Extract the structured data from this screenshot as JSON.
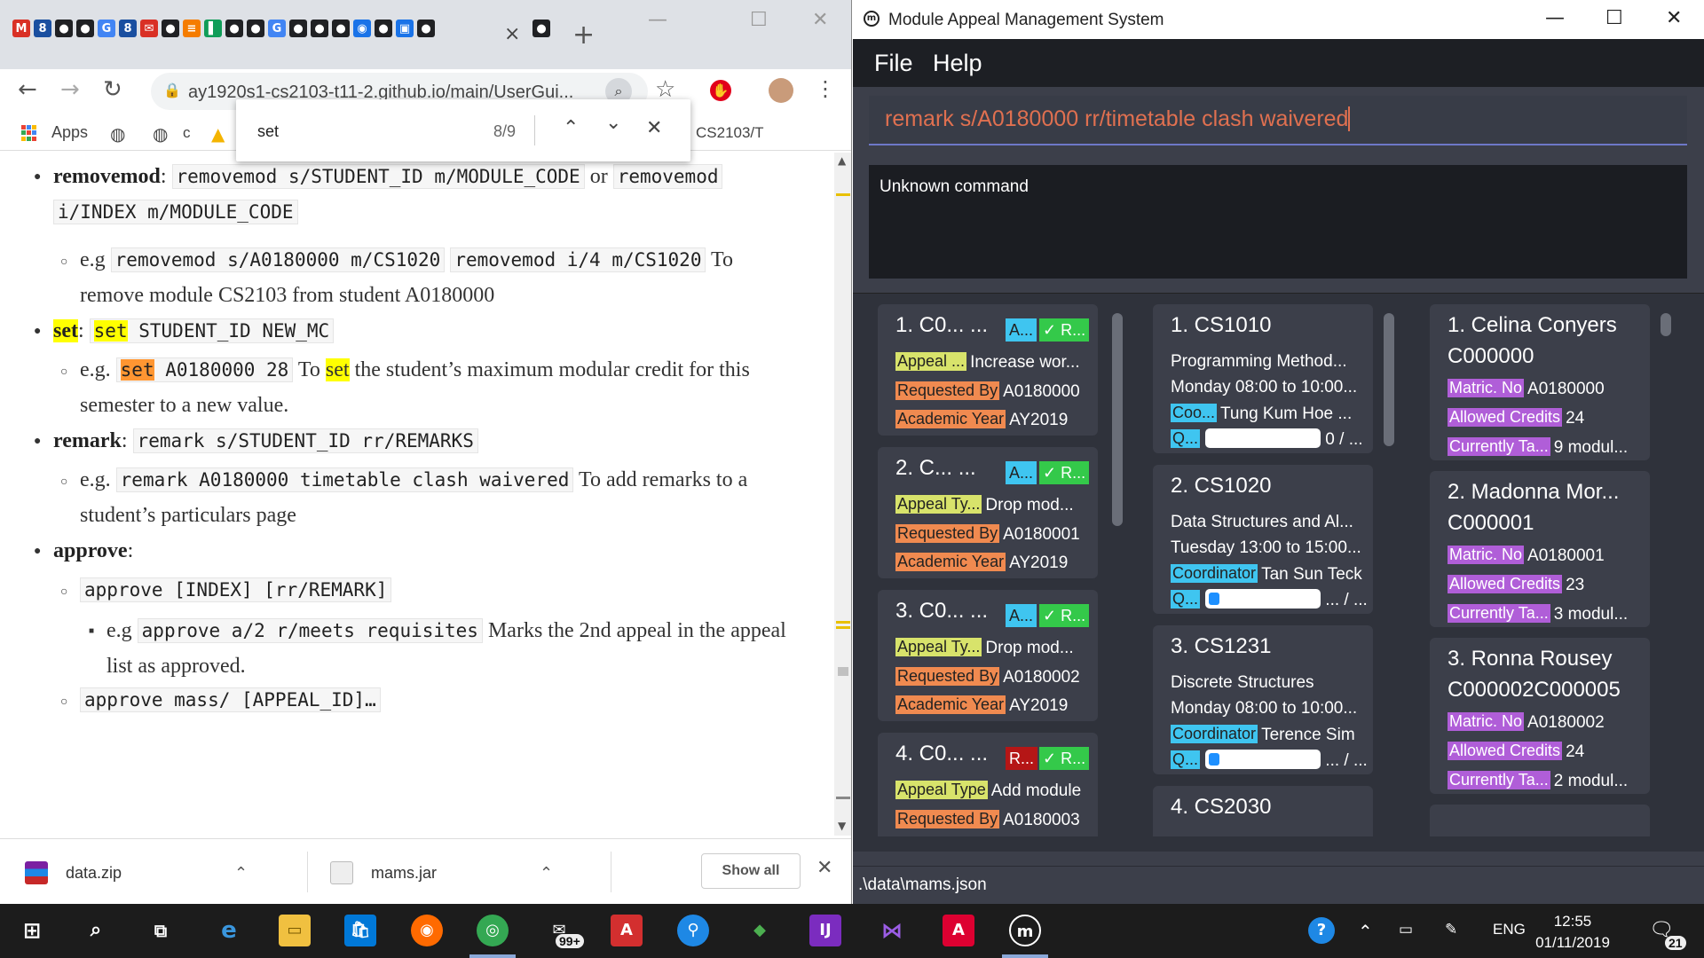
{
  "browser": {
    "tab_close": "×",
    "new_tab": "+",
    "window_controls": [
      "—",
      "☐",
      "✕"
    ],
    "url": "ay1920s1-cs2103-t11-2.github.io/main/UserGui...",
    "bookmarks": {
      "apps_label": "Apps",
      "item_c": "c",
      "item_cs2103": "CS2103/T"
    },
    "find_bar": {
      "query": "set",
      "count": "8/9"
    },
    "content": {
      "removemod_term": "removemod",
      "removemod_sep": ":",
      "removemod_syntax1": "removemod s/STUDENT_ID m/MODULE_CODE",
      "removemod_or": "or",
      "removemod_syntax2a": "removemod",
      "removemod_syntax2b": "i/INDEX m/MODULE_CODE",
      "removemod_eg": "e.g",
      "removemod_ex1": "removemod s/A0180000 m/CS1020",
      "removemod_ex2": "removemod i/4 m/CS1020",
      "removemod_desc1": "To",
      "removemod_desc2": "remove module CS2103 from student A0180000",
      "set_term": "set",
      "set_sep": ":",
      "set_syntax_kw": "set",
      "set_syntax_rest": "STUDENT_ID NEW_MC",
      "set_eg": "e.g.",
      "set_ex_kw": "set",
      "set_ex_rest": "A0180000 28",
      "set_desc_a": "To",
      "set_desc_kw": "set",
      "set_desc_b": "the student’s maximum modular credit for this",
      "set_desc_c": "semester to a new value.",
      "remark_term": "remark",
      "remark_sep": ":",
      "remark_syntax": "remark s/STUDENT_ID rr/REMARKS",
      "remark_eg": "e.g.",
      "remark_ex": "remark A0180000 timetable clash waivered",
      "remark_desc1": "To add remarks to a",
      "remark_desc2": "student’s particulars page",
      "approve_term": "approve",
      "approve_sep": ":",
      "approve_syntax": "approve [INDEX] [rr/REMARK]",
      "approve_eg": "e.g",
      "approve_ex": "approve a/2 r/meets requisites",
      "approve_desc1": "Marks the 2nd appeal in the appeal",
      "approve_desc2": "list as approved.",
      "approve_mass": "approve mass/ [APPEAL_ID]…"
    },
    "downloads": {
      "items": [
        {
          "name": "data.zip"
        },
        {
          "name": "mams.jar"
        }
      ],
      "show_all": "Show all",
      "close": "✕"
    }
  },
  "app": {
    "title": "Module Appeal Management System",
    "logo_letter": "m",
    "menu": [
      "File",
      "Help"
    ],
    "command_text": "remark s/A0180000 rr/timetable clash waivered",
    "result_text": "Unknown command",
    "status_path": ".\\data\\mams.json",
    "appeals": [
      {
        "head": "1.  C0...   ...",
        "status1": "A...",
        "status2": "✓ R...",
        "l1_tag": "Appeal ...",
        "l1_val": "Increase wor...",
        "l2_tag": "Requested By",
        "l2_val": "A0180000",
        "l3_tag": "Academic Year",
        "l3_val": "AY2019"
      },
      {
        "head": "2.  C...    ...",
        "status1": "A...",
        "status2": "✓ R...",
        "l1_tag": "Appeal Ty...",
        "l1_val": "Drop mod...",
        "l2_tag": "Requested By",
        "l2_val": "A0180001",
        "l3_tag": "Academic Year",
        "l3_val": "AY2019"
      },
      {
        "head": "3.  C0...   ...",
        "status1": "A...",
        "status2": "✓ R...",
        "l1_tag": "Appeal Ty...",
        "l1_val": "Drop mod...",
        "l2_tag": "Requested By",
        "l2_val": "A0180002",
        "l3_tag": "Academic Year",
        "l3_val": "AY2019"
      },
      {
        "head": "4.  C0...   ...",
        "status1": "R...",
        "status2": "✓ R...",
        "l1_tag": "Appeal Type",
        "l1_val": "Add module",
        "l2_tag": "Requested By",
        "l2_val": "A0180003"
      }
    ],
    "modules": [
      {
        "head": "1.  CS1010",
        "name": "Programming Method...",
        "time": "Monday 08:00 to 10:00...",
        "coord_tag": "Coo...",
        "coord_val": "Tung Kum Hoe ...",
        "q_tag": "Q...",
        "quota": "0 / ...",
        "fill": 0.0
      },
      {
        "head": "2.  CS1020",
        "name": "Data Structures and Al...",
        "time": "Tuesday 13:00 to 15:00...",
        "coord_tag": "Coordinator",
        "coord_val": "Tan Sun Teck",
        "q_tag": "Q...",
        "quota": "... / ...",
        "fill": 0.08
      },
      {
        "head": "3.  CS1231",
        "name": "Discrete Structures",
        "time": "Monday 08:00 to 10:00...",
        "coord_tag": "Coordinator",
        "coord_val": "Terence Sim",
        "q_tag": "Q...",
        "quota": "... / ...",
        "fill": 0.1
      },
      {
        "head": "4.  CS2030"
      }
    ],
    "students": [
      {
        "head": "1.  Celina Conyers",
        "id": "C000000",
        "l1_tag": "Matric. No",
        "l1_val": "A0180000",
        "l2_tag": "Allowed Credits",
        "l2_val": "24",
        "l3_tag": "Currently Ta...",
        "l3_val": "9  modul..."
      },
      {
        "head": "2.  Madonna Mor...",
        "id": "C000001",
        "l1_tag": "Matric. No",
        "l1_val": "A0180001",
        "l2_tag": "Allowed Credits",
        "l2_val": "23",
        "l3_tag": "Currently Ta...",
        "l3_val": "3  modul..."
      },
      {
        "head": "3.  Ronna Rousey",
        "id": "C000002C000005",
        "l1_tag": "Matric. No",
        "l1_val": "A0180002",
        "l2_tag": "Allowed Credits",
        "l2_val": "24",
        "l3_tag": "Currently Ta...",
        "l3_val": "2  modul..."
      }
    ],
    "colors": {
      "tag_green": "#d8e36b",
      "tag_orange": "#f08a50",
      "tag_purple": "#b05ed8",
      "tag_blue": "#3fc5f0",
      "status_green": "#34c94a",
      "status_red": "#b51616",
      "command_text": "#e07050"
    }
  },
  "taskbar": {
    "language": "ENG",
    "time": "12:55",
    "date": "01/11/2019",
    "mail_badge": "99+",
    "notification_count": "21"
  }
}
